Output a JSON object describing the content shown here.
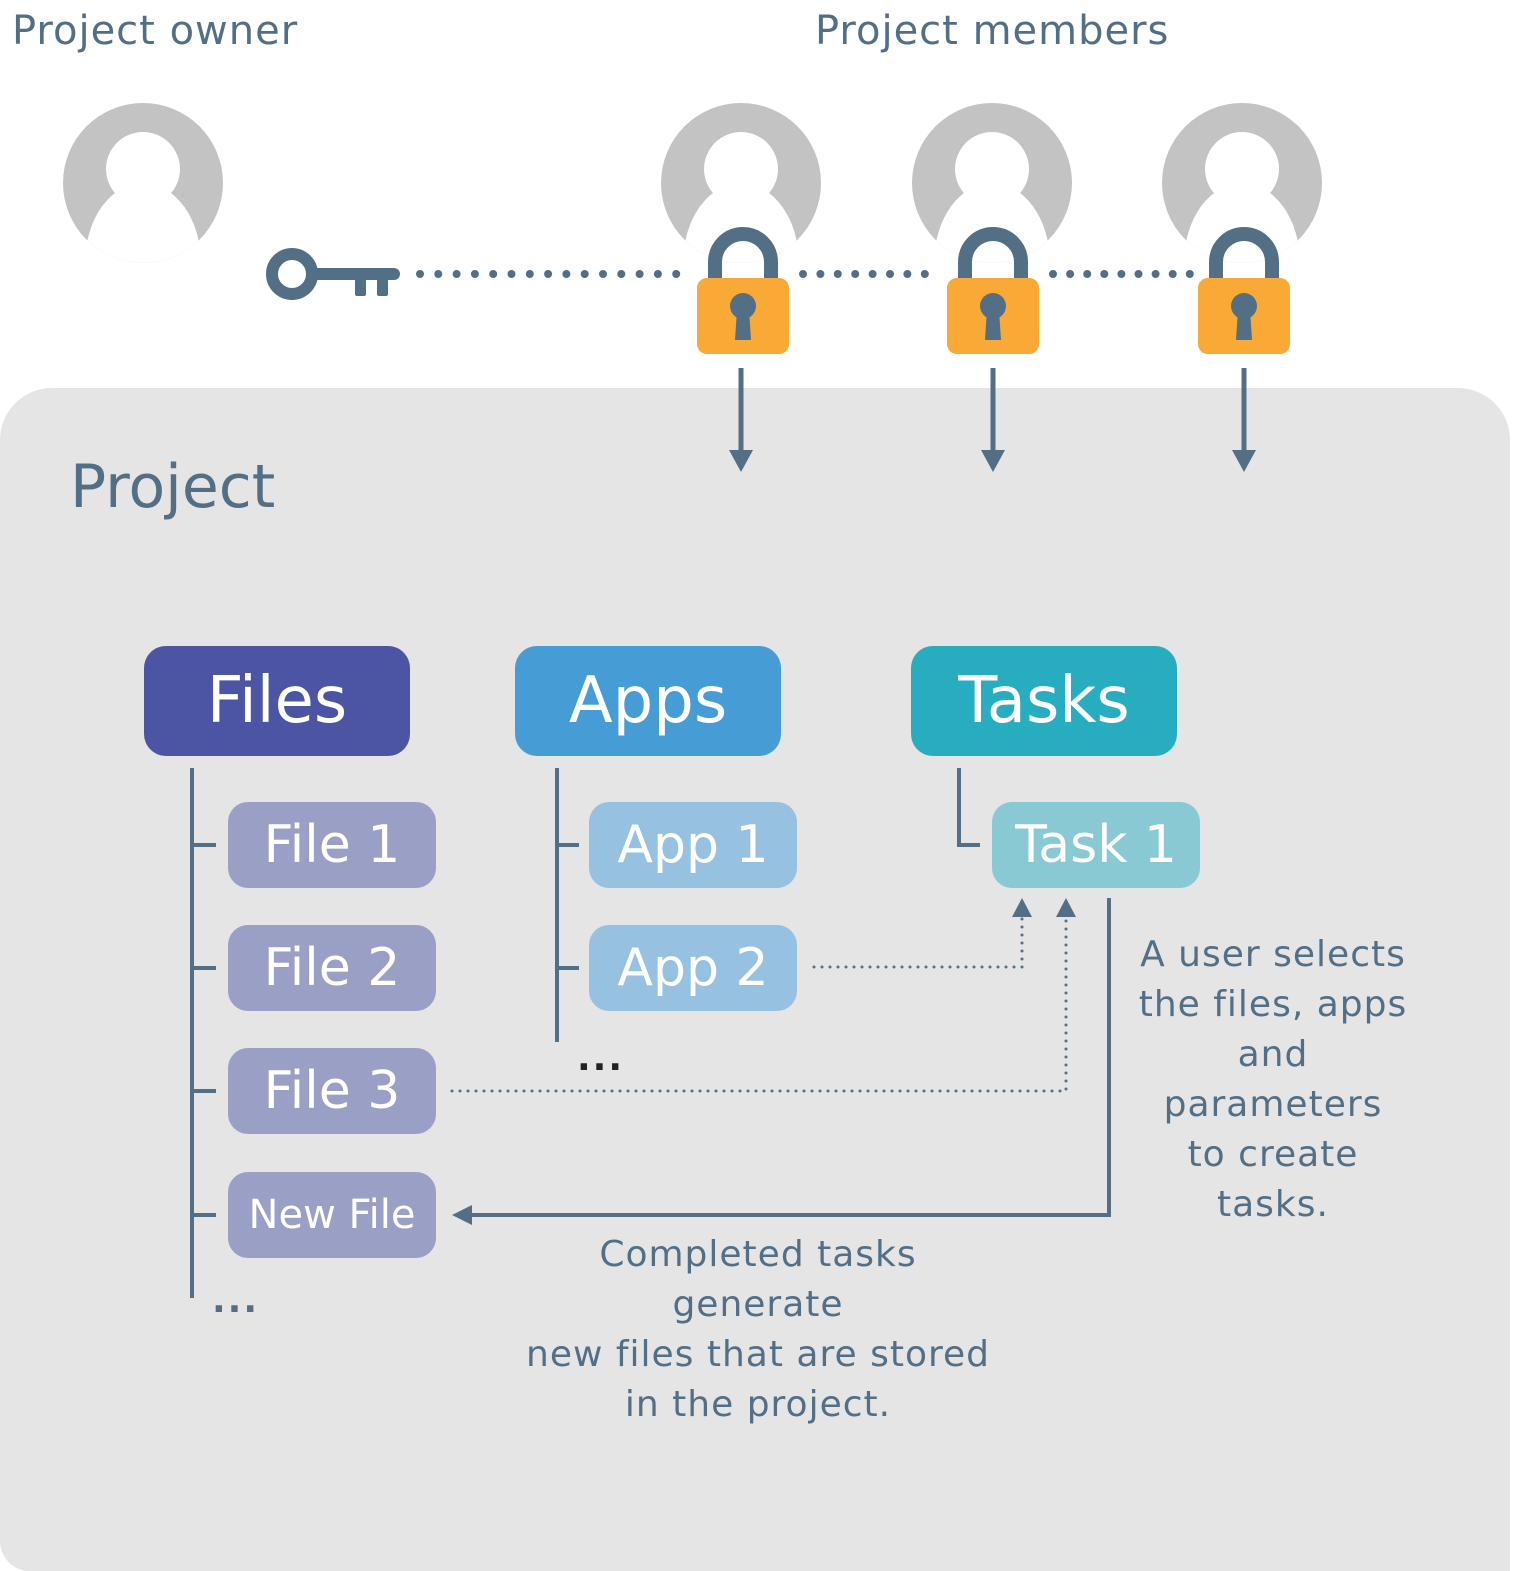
{
  "header": {
    "owner_label": "Project owner",
    "members_label": "Project members"
  },
  "icons": {
    "owner_avatar": "user-avatar-icon",
    "owner_key": "key-icon",
    "member_avatar": "user-avatar-icon",
    "member_lock": "padlock-icon"
  },
  "members": [
    {
      "lock": "locked"
    },
    {
      "lock": "locked"
    },
    {
      "lock": "locked"
    }
  ],
  "project": {
    "title": "Project",
    "columns": {
      "files": {
        "label": "Files",
        "items": [
          "File 1",
          "File 2",
          "File 3",
          "New File"
        ],
        "more": "..."
      },
      "apps": {
        "label": "Apps",
        "items": [
          "App 1",
          "App 2"
        ],
        "more": "..."
      },
      "tasks": {
        "label": "Tasks",
        "items": [
          "Task 1"
        ]
      }
    },
    "notes": {
      "task_creation": [
        "A user selects",
        "the files, apps",
        "and parameters",
        "to create tasks."
      ],
      "task_output": [
        "Completed tasks generate",
        "new files that are stored",
        "in the project."
      ]
    }
  },
  "colors": {
    "text": "#536f86",
    "files_header": "#4b55a4",
    "files_item": "#9a9fc6",
    "apps_header": "#469dd6",
    "apps_item": "#96c1e0",
    "tasks_header": "#28acbf",
    "tasks_item": "#88c9d3",
    "lock_body": "#f9a935",
    "avatar": "#c3c3c3",
    "panel": "#e5e5e5"
  }
}
